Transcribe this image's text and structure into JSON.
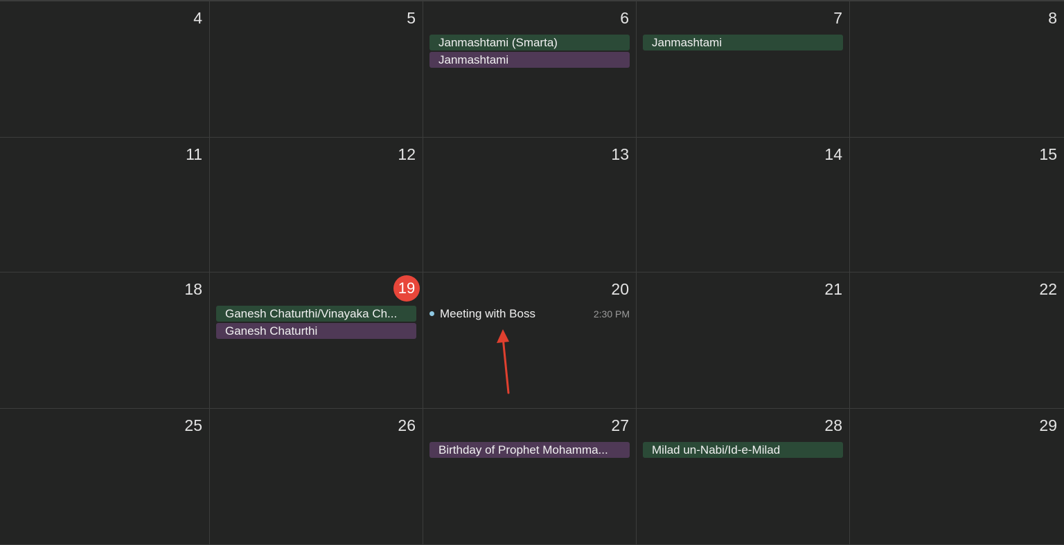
{
  "calendar": {
    "weeks": [
      {
        "days": [
          {
            "num": "4",
            "events": []
          },
          {
            "num": "5",
            "events": []
          },
          {
            "num": "6",
            "events": [
              {
                "title": "Janmashtami (Smarta)",
                "color": "green"
              },
              {
                "title": "Janmashtami",
                "color": "purple"
              }
            ]
          },
          {
            "num": "7",
            "events": [
              {
                "title": "Janmashtami",
                "color": "green"
              }
            ]
          },
          {
            "num": "8",
            "events": []
          }
        ]
      },
      {
        "days": [
          {
            "num": "11",
            "events": []
          },
          {
            "num": "12",
            "events": []
          },
          {
            "num": "13",
            "events": []
          },
          {
            "num": "14",
            "events": []
          },
          {
            "num": "15",
            "events": []
          }
        ]
      },
      {
        "days": [
          {
            "num": "18",
            "events": []
          },
          {
            "num": "19",
            "today": true,
            "events": [
              {
                "title": "Ganesh Chaturthi/Vinayaka Ch...",
                "color": "green"
              },
              {
                "title": "Ganesh Chaturthi",
                "color": "purple"
              }
            ]
          },
          {
            "num": "20",
            "events": [
              {
                "title": "Meeting with Boss",
                "time": "2:30 PM",
                "timed": true
              }
            ]
          },
          {
            "num": "21",
            "events": []
          },
          {
            "num": "22",
            "events": []
          }
        ]
      },
      {
        "days": [
          {
            "num": "25",
            "events": []
          },
          {
            "num": "26",
            "events": []
          },
          {
            "num": "27",
            "events": [
              {
                "title": "Birthday of Prophet Mohamma...",
                "color": "purple"
              }
            ]
          },
          {
            "num": "28",
            "events": [
              {
                "title": "Milad un-Nabi/Id-e-Milad",
                "color": "green"
              }
            ]
          },
          {
            "num": "29",
            "events": []
          }
        ]
      }
    ]
  },
  "colors": {
    "background": "#232423",
    "grid_line": "#3c3d3c",
    "today_badge": "#e8463a",
    "green_event": "#2b4a37",
    "purple_event": "#4f3956",
    "timed_dot": "#8fc9e3",
    "annotation_arrow": "#e0402f"
  },
  "annotation": {
    "icon": "red-arrow-icon"
  }
}
